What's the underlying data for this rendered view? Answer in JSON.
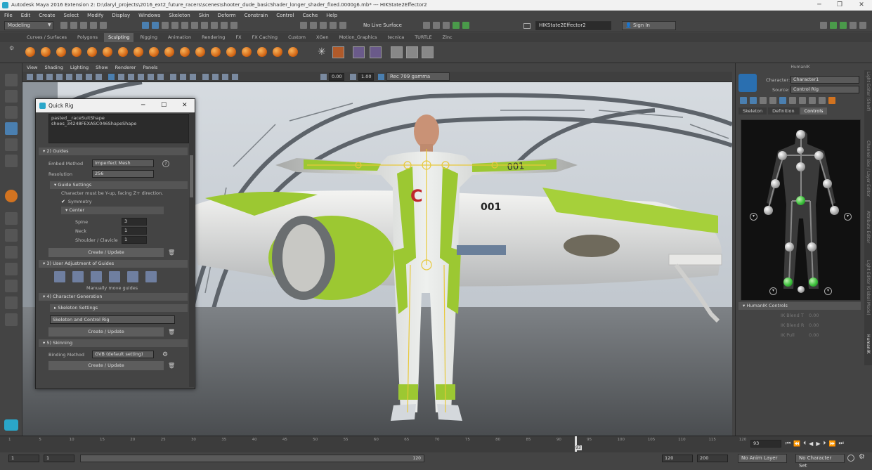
{
  "window": {
    "title": "Autodesk Maya 2016 Extension 2: D:\\daryl_projects\\2016_ext2_future_racers\\scenes\\shooter_dude_basicShader_longer_shader_fixed.0000g6.mb* --- HIKState2Effector2"
  },
  "menubar": [
    "File",
    "Edit",
    "Create",
    "Select",
    "Modify",
    "Display",
    "Windows",
    "Skeleton",
    "Skin",
    "Deform",
    "Constrain",
    "Control",
    "Cache",
    "Help"
  ],
  "statusline": {
    "mode": "Modeling",
    "live_surface": "No Live Surface",
    "field_value": "HIKState2Effector2",
    "sign_in": "Sign In"
  },
  "shelf_tabs": [
    "Curves / Surfaces",
    "Polygons",
    "Sculpting",
    "Rigging",
    "Animation",
    "Rendering",
    "FX",
    "FX Caching",
    "Custom",
    "XGen",
    "Motion_Graphics",
    "tecnica",
    "TURTLE",
    "Zinc"
  ],
  "shelf_active": "Sculpting",
  "viewport": {
    "menu": [
      "View",
      "Shading",
      "Lighting",
      "Show",
      "Renderer",
      "Panels"
    ],
    "exposure": "0.00",
    "gamma": "1.00",
    "color_space": "Rec 709 gamma",
    "ship_label": "001",
    "ship_tail": "001",
    "suit_logo": "C"
  },
  "quick_rig": {
    "title": "Quick Rig",
    "list_items": [
      "pasted__raceSuitShape",
      "shoes_34248FEXASC046ShapeShape"
    ],
    "sec_guides": "2) Guides",
    "embed_method_label": "Embed Method",
    "embed_method_value": "Imperfect Mesh",
    "resolution_label": "Resolution",
    "resolution_value": "256",
    "guide_settings": "Guide Settings",
    "guide_note": "Character must be Y-up, facing Z+ direction.",
    "symmetry": "Symmetry",
    "center": "Center",
    "spine_label": "Spine",
    "spine_value": "3",
    "neck_label": "Neck",
    "neck_value": "1",
    "shoulder_label": "Shoulder / Clavicle",
    "shoulder_value": "1",
    "create_update": "Create / Update",
    "sec_user_adjust": "3) User Adjustment of Guides",
    "manual_move": "Manually move guides",
    "sec_char_gen": "4) Character Generation",
    "skeleton_settings": "Skeleton Settings",
    "skeleton_value": "Skeleton and Control Rig",
    "sec_skinning": "5) Skinning",
    "binding_label": "Binding Method",
    "binding_value": "GVB (default setting)"
  },
  "humanik": {
    "title": "HumanIK",
    "character_label": "Character:",
    "character_value": "Character1",
    "source_label": "Source:",
    "source_value": "Control Rig",
    "tabs": [
      "Skeleton",
      "Definition",
      "Controls"
    ],
    "active_tab": "Controls",
    "controls_header": "HumanIK Controls",
    "blend_t": "IK Blend T",
    "blend_r": "IK Blend R",
    "pull": "IK Pull",
    "zero": "0.00"
  },
  "side_tabs": [
    "Light Editor (Shelf)",
    "Channel Box / Layer Editor",
    "Attribute Editor",
    "Light Editor (Global Mode)",
    "HumanIK"
  ],
  "timeline": {
    "ticks": [
      "1",
      "5",
      "10",
      "15",
      "20",
      "25",
      "30",
      "35",
      "40",
      "45",
      "50",
      "55",
      "60",
      "65",
      "70",
      "75",
      "80",
      "85",
      "90",
      "95",
      "100",
      "105",
      "110",
      "115",
      "120"
    ],
    "current_frame": "93",
    "playhead": "93"
  },
  "range": {
    "start": "1",
    "start2": "1",
    "range_end_marker": "120",
    "end": "120",
    "end2": "200",
    "anim_layer": "No Anim Layer",
    "char_set": "No Character Set"
  }
}
